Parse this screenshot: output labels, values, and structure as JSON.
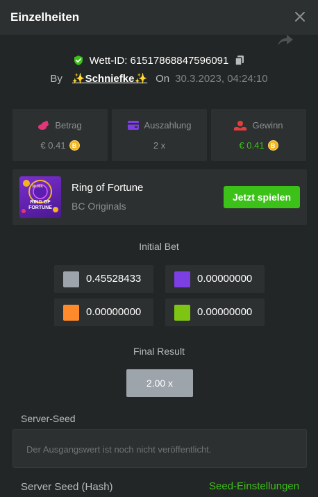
{
  "header": {
    "title": "Einzelheiten"
  },
  "bet": {
    "id_label": "Wett-ID: 61517868847596091",
    "by_label": "By",
    "username": "✨Schniefke✨",
    "on_label": "On",
    "date": "30.3.2023, 04:24:10"
  },
  "stats": [
    {
      "label": "Betrag",
      "value": "€ 0.41",
      "icon": "coins-icon",
      "icon_color": "#e2367a",
      "value_color": "#8c9090"
    },
    {
      "label": "Auszahlung",
      "value": "2 x",
      "icon": "wallet-icon",
      "icon_color": "#7b3fe4",
      "value_color": "#8c9090"
    },
    {
      "label": "Gewinn",
      "value": "€ 0.41",
      "icon": "profit-icon",
      "icon_color": "#e23e3e",
      "value_color": "#3bc117"
    }
  ],
  "coin_symbol": "B",
  "game": {
    "title": "Ring of Fortune",
    "provider": "BC Originals",
    "play_label": "Jetzt spielen",
    "thumb_text": "RING OF FORTUNE",
    "thumb_badge": "30.00X"
  },
  "initial_bet": {
    "title": "Initial Bet",
    "cells": [
      {
        "color": "#9ea4ab",
        "value": "0.45528433"
      },
      {
        "color": "#7b3fe4",
        "value": "0.00000000"
      },
      {
        "color": "#ff8a2b",
        "value": "0.00000000"
      },
      {
        "color": "#7ec513",
        "value": "0.00000000"
      }
    ]
  },
  "final_result": {
    "title": "Final Result",
    "value": "2.00 x",
    "color": "#9ea4ab"
  },
  "server_seed": {
    "label": "Server-Seed",
    "placeholder": "Der Ausgangswert ist noch nicht veröffentlicht."
  },
  "server_seed_hash": {
    "label": "Server Seed (Hash)",
    "settings_label": "Seed-Einstellungen"
  },
  "colors": {
    "accent": "#3bc117",
    "panel": "#2d3030",
    "background": "#232626"
  }
}
